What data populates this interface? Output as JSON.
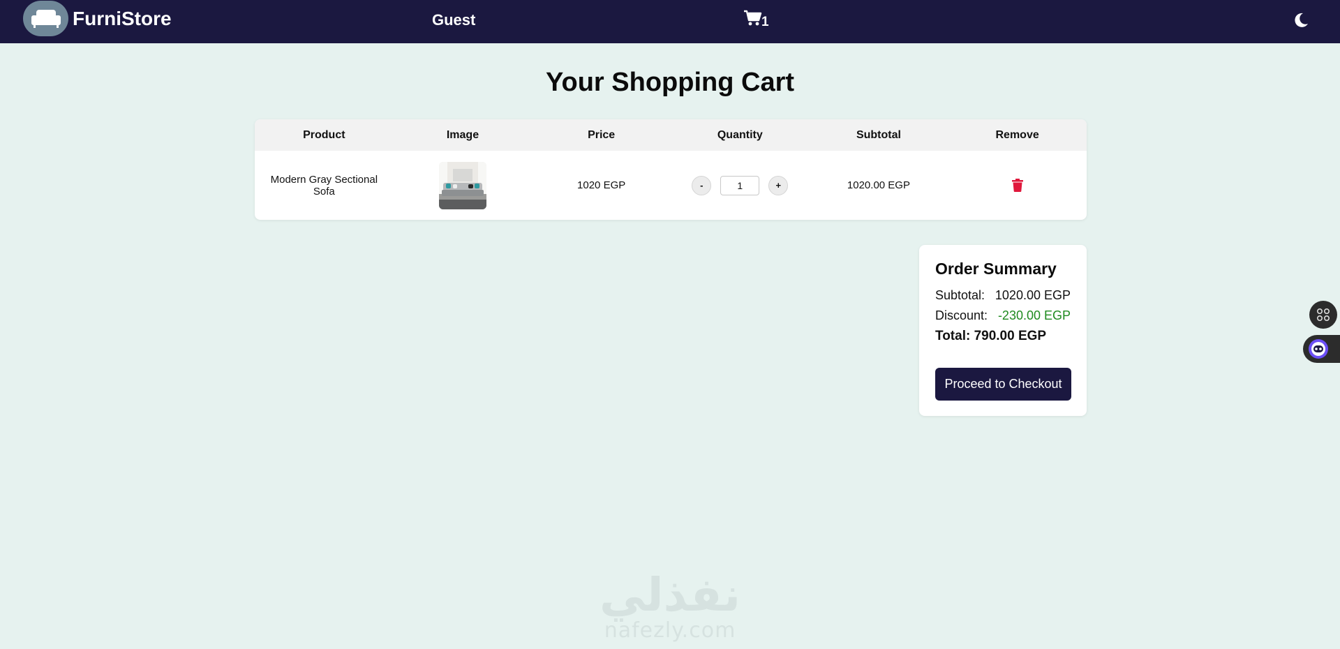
{
  "navbar": {
    "brand_name": "FurniStore",
    "user_label": "Guest",
    "cart_count": "1",
    "logo_icon": "sofa-icon",
    "cart_icon": "cart-icon",
    "theme_icon": "moon-icon"
  },
  "page": {
    "title": "Your Shopping Cart"
  },
  "cart": {
    "headers": [
      "Product",
      "Image",
      "Price",
      "Quantity",
      "Subtotal",
      "Remove"
    ],
    "items": [
      {
        "product": "Modern Gray Sectional Sofa",
        "price": "1020 EGP",
        "quantity": "1",
        "subtotal": "1020.00 EGP",
        "decrement_label": "-",
        "increment_label": "+",
        "remove_icon": "trash-icon"
      }
    ]
  },
  "summary": {
    "title": "Order Summary",
    "subtotal_label": "Subtotal:",
    "subtotal_value": "1020.00 EGP",
    "discount_label": "Discount:",
    "discount_value": "-230.00 EGP",
    "total_text": "Total: 790.00 EGP",
    "checkout_label": "Proceed to Checkout"
  },
  "watermark": {
    "arabic": "نفذلي",
    "latin": "nafezly.com"
  },
  "colors": {
    "navbar": "#1b1840",
    "background": "#e6f2ef",
    "discount": "#1f8a1f",
    "remove": "#e0183c"
  }
}
